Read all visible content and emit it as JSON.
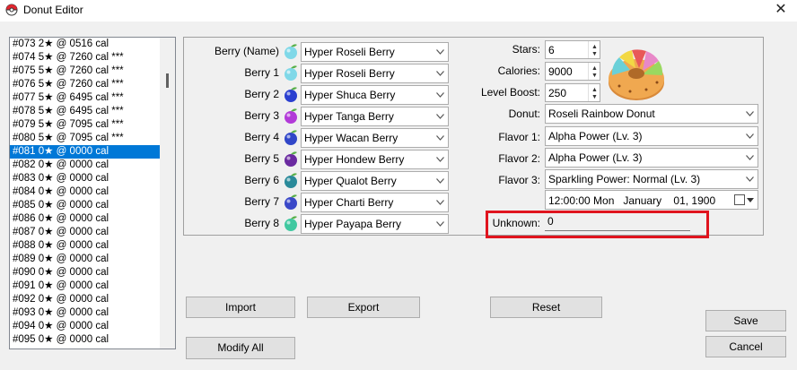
{
  "window": {
    "title": "Donut Editor",
    "close_glyph": "✕"
  },
  "donut_list": {
    "selected_index": 8,
    "items": [
      "#073 2★ @ 0516 cal",
      "#074 5★ @ 7260 cal ***",
      "#075 5★ @ 7260 cal ***",
      "#076 5★ @ 7260 cal ***",
      "#077 5★ @ 6495 cal ***",
      "#078 5★ @ 6495 cal ***",
      "#079 5★ @ 7095 cal ***",
      "#080 5★ @ 7095 cal ***",
      "#081 0★ @ 0000 cal",
      "#082 0★ @ 0000 cal",
      "#083 0★ @ 0000 cal",
      "#084 0★ @ 0000 cal",
      "#085 0★ @ 0000 cal",
      "#086 0★ @ 0000 cal",
      "#087 0★ @ 0000 cal",
      "#088 0★ @ 0000 cal",
      "#089 0★ @ 0000 cal",
      "#090 0★ @ 0000 cal",
      "#091 0★ @ 0000 cal",
      "#092 0★ @ 0000 cal",
      "#093 0★ @ 0000 cal",
      "#094 0★ @ 0000 cal",
      "#095 0★ @ 0000 cal"
    ]
  },
  "berries": [
    {
      "label": "Berry (Name)",
      "value": "Hyper Roseli Berry",
      "icon": "roseli-berry-icon",
      "color": "#7fd8e8"
    },
    {
      "label": "Berry 1",
      "value": "Hyper Roseli Berry",
      "icon": "roseli-berry-icon",
      "color": "#7fd8e8"
    },
    {
      "label": "Berry 2",
      "value": "Hyper Shuca Berry",
      "icon": "shuca-berry-icon",
      "color": "#2a3fd0"
    },
    {
      "label": "Berry 3",
      "value": "Hyper Tanga Berry",
      "icon": "tanga-berry-icon",
      "color": "#b23ad8"
    },
    {
      "label": "Berry 4",
      "value": "Hyper Wacan Berry",
      "icon": "wacan-berry-icon",
      "color": "#3046c8"
    },
    {
      "label": "Berry 5",
      "value": "Hyper Hondew Berry",
      "icon": "hondew-berry-icon",
      "color": "#6a2aa0"
    },
    {
      "label": "Berry 6",
      "value": "Hyper Qualot Berry",
      "icon": "qualot-berry-icon",
      "color": "#2a8a9a"
    },
    {
      "label": "Berry 7",
      "value": "Hyper Charti Berry",
      "icon": "charti-berry-icon",
      "color": "#3a48c8"
    },
    {
      "label": "Berry 8",
      "value": "Hyper Payapa Berry",
      "icon": "payapa-berry-icon",
      "color": "#40c8a0"
    }
  ],
  "stars": {
    "label": "Stars:",
    "value": "6"
  },
  "calories": {
    "label": "Calories:",
    "value": "9000"
  },
  "level_boost": {
    "label": "Level Boost:",
    "value": "250"
  },
  "donut": {
    "label": "Donut:",
    "value": "Roseli Rainbow Donut"
  },
  "flavor1": {
    "label": "Flavor 1:",
    "value": "Alpha Power (Lv. 3)"
  },
  "flavor2": {
    "label": "Flavor 2:",
    "value": "Alpha Power (Lv. 3)"
  },
  "flavor3": {
    "label": "Flavor 3:",
    "value": "Sparkling Power: Normal (Lv. 3)"
  },
  "timestamp": {
    "value": "12:00:00 Mon   January    01, 1900"
  },
  "unknown": {
    "label": "Unknown:",
    "value": "0"
  },
  "buttons": {
    "import": "Import",
    "export": "Export",
    "reset": "Reset",
    "modify_all": "Modify All",
    "save": "Save",
    "cancel": "Cancel"
  },
  "colors": {
    "selection": "#0078d7",
    "highlight_box": "#e0141e"
  }
}
